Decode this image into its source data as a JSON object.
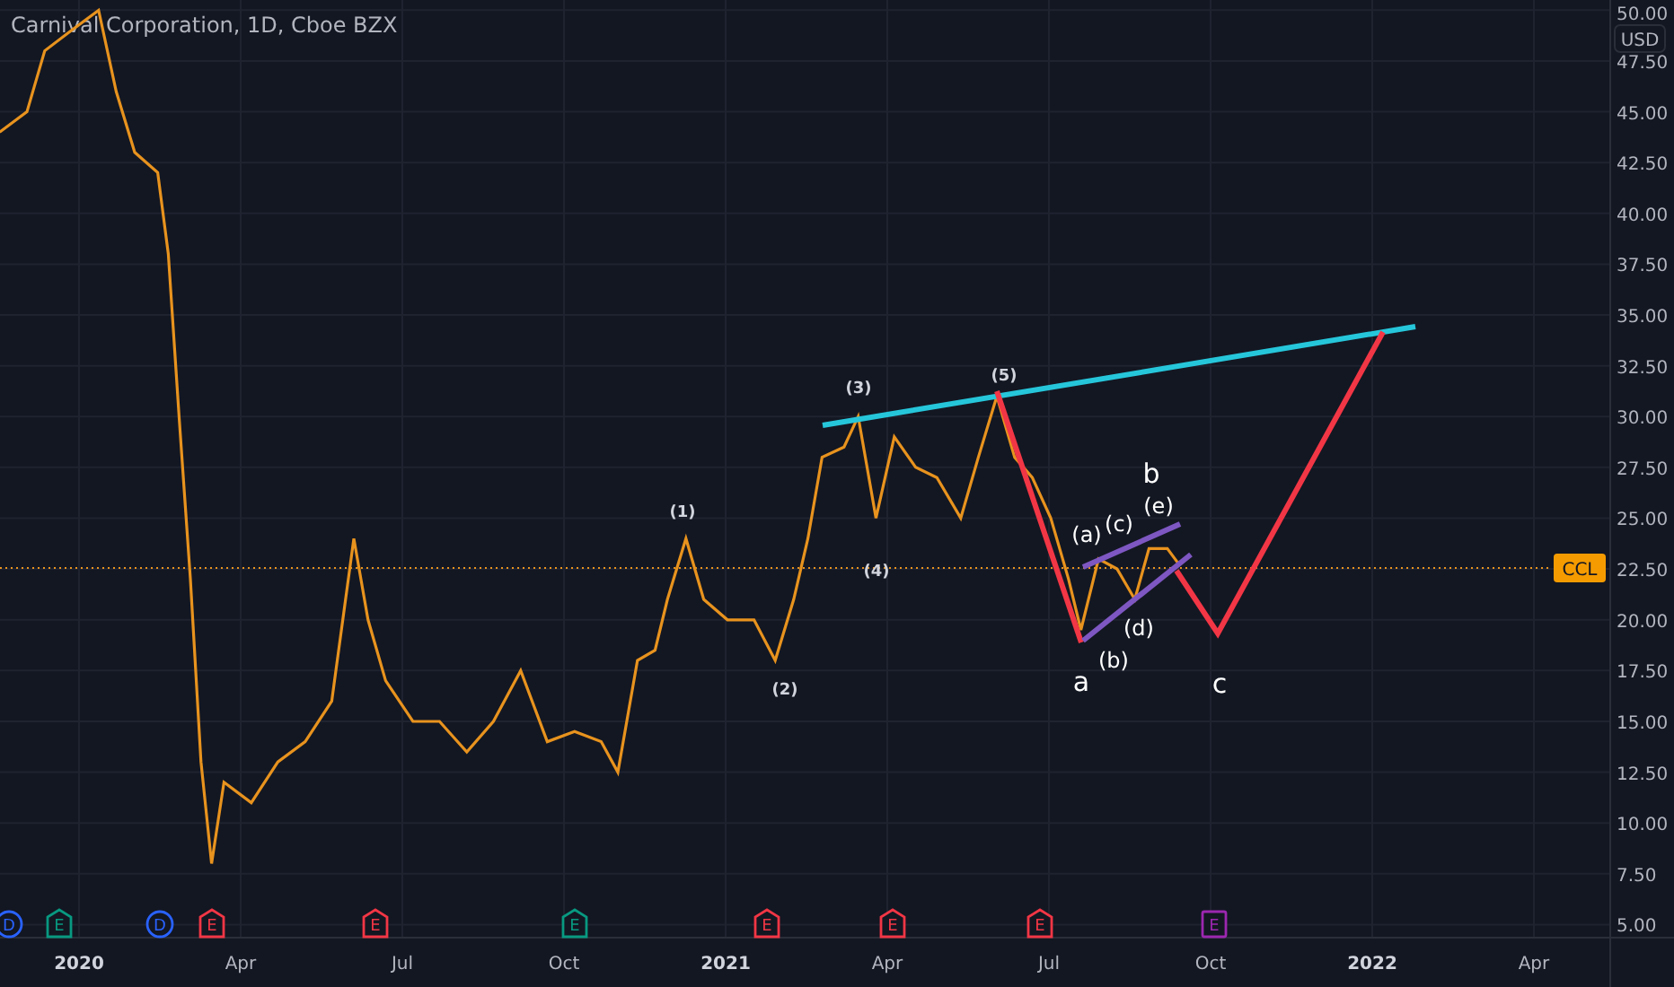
{
  "currency": "USD",
  "chart_data": {
    "type": "line",
    "title": "Carnival Corporation, 1D, Cboe BZX",
    "grid": true,
    "xlim": [
      "2019-11-15",
      "2022-06-19"
    ],
    "ylim": [
      4.4,
      50.5
    ],
    "x": [
      "2019-11-17",
      "2019-12-02",
      "2019-12-12",
      "2019-12-27",
      "2020-01-12",
      "2020-01-22",
      "2020-02-02",
      "2020-02-15",
      "2020-02-21",
      "2020-02-27",
      "2020-03-03",
      "2020-03-09",
      "2020-03-15",
      "2020-03-22",
      "2020-04-07",
      "2020-04-22",
      "2020-05-07",
      "2020-05-22",
      "2020-06-04",
      "2020-06-12",
      "2020-06-22",
      "2020-07-07",
      "2020-07-22",
      "2020-08-07",
      "2020-08-22",
      "2020-09-07",
      "2020-09-22",
      "2020-10-07",
      "2020-10-22",
      "2020-11-01",
      "2020-11-12",
      "2020-11-22",
      "2020-11-29",
      "2020-12-09",
      "2020-12-19",
      "2021-01-02",
      "2021-01-17",
      "2021-01-29",
      "2021-02-09",
      "2021-02-17",
      "2021-02-25",
      "2021-03-07",
      "2021-03-15",
      "2021-03-25",
      "2021-04-05",
      "2021-04-17",
      "2021-04-29",
      "2021-05-12",
      "2021-05-22",
      "2021-06-02",
      "2021-06-12",
      "2021-06-22",
      "2021-07-02",
      "2021-07-12",
      "2021-07-19",
      "2021-07-29",
      "2021-08-09",
      "2021-08-19",
      "2021-08-27",
      "2021-09-07",
      "2021-09-13"
    ],
    "series": [
      {
        "name": "CCL",
        "color": "#e8931e",
        "values": [
          44,
          45,
          48,
          49,
          50,
          46,
          43,
          42,
          38,
          30,
          22,
          13,
          8,
          12,
          11,
          13,
          14,
          16,
          24,
          20,
          17,
          15,
          15,
          13.5,
          15,
          17.5,
          14,
          14.5,
          14,
          12.5,
          18,
          18.5,
          21,
          24,
          21,
          20,
          20,
          18,
          21,
          24,
          28,
          28.5,
          30,
          25,
          29,
          27.5,
          27,
          25,
          28,
          31,
          28,
          27,
          25,
          22,
          19.5,
          23,
          22.5,
          21,
          23.5,
          23.5,
          22.8
        ]
      }
    ],
    "yticks": [
      {
        "value": 5,
        "label": "5.00"
      },
      {
        "value": 7.5,
        "label": "7.50"
      },
      {
        "value": 10,
        "label": "10.00"
      },
      {
        "value": 12.5,
        "label": "12.50"
      },
      {
        "value": 15,
        "label": "15.00"
      },
      {
        "value": 17.5,
        "label": "17.50"
      },
      {
        "value": 20,
        "label": "20.00"
      },
      {
        "value": 22.5,
        "label": "22.50"
      },
      {
        "value": 25,
        "label": "25.00"
      },
      {
        "value": 27.5,
        "label": "27.50"
      },
      {
        "value": 30,
        "label": "30.00"
      },
      {
        "value": 32.5,
        "label": "32.50"
      },
      {
        "value": 35,
        "label": "35.00"
      },
      {
        "value": 37.5,
        "label": "37.50"
      },
      {
        "value": 40,
        "label": "40.00"
      },
      {
        "value": 42.5,
        "label": "42.50"
      },
      {
        "value": 45,
        "label": "45.00"
      },
      {
        "value": 47.5,
        "label": "47.50"
      },
      {
        "value": 50,
        "label": "50.00"
      }
    ],
    "xticks": [
      {
        "value": "2020-01-01",
        "label": "2020"
      },
      {
        "value": "2020-04-01",
        "label": "Apr"
      },
      {
        "value": "2020-07-01",
        "label": "Jul"
      },
      {
        "value": "2020-10-01",
        "label": "Oct"
      },
      {
        "value": "2021-01-01",
        "label": "2021"
      },
      {
        "value": "2021-04-01",
        "label": "Apr"
      },
      {
        "value": "2021-07-01",
        "label": "Jul"
      },
      {
        "value": "2021-10-01",
        "label": "Oct"
      },
      {
        "value": "2022-01-01",
        "label": "2022"
      },
      {
        "value": "2022-04-01",
        "label": "Apr"
      }
    ],
    "annotations": [
      "(1)",
      "(2)",
      "(3)",
      "(4)",
      "(5)",
      "a",
      "(b)",
      "(a)",
      "(c)",
      "(d)",
      "(e)",
      "b",
      "c"
    ]
  },
  "events": [
    {
      "kind": "dividend",
      "letter": "D",
      "color": "#2962ff"
    },
    {
      "kind": "earnings",
      "letter": "E",
      "color": "#089981"
    },
    {
      "kind": "dividend",
      "letter": "D",
      "color": "#2962ff"
    },
    {
      "kind": "earnings",
      "letter": "E",
      "color": "#f23645"
    },
    {
      "kind": "earnings",
      "letter": "E",
      "color": "#f23645"
    },
    {
      "kind": "earnings",
      "letter": "E",
      "color": "#089981"
    },
    {
      "kind": "earnings",
      "letter": "E",
      "color": "#f23645"
    },
    {
      "kind": "earnings",
      "letter": "E",
      "color": "#f23645"
    },
    {
      "kind": "earnings",
      "letter": "E",
      "color": "#f23645"
    },
    {
      "kind": "upcoming",
      "letter": "E",
      "color": "#9c27b0"
    }
  ]
}
